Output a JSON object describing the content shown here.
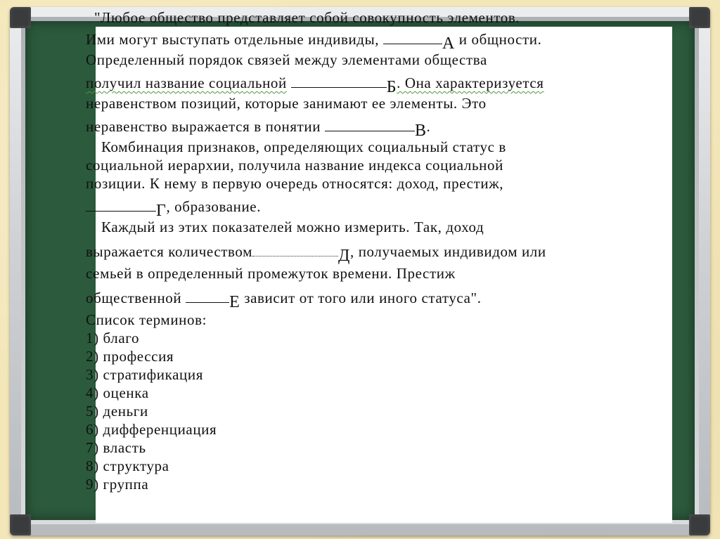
{
  "document": {
    "lines": [
      "\"Любое общество представляет собой совокупность элементов.",
      "Ими могут выступать отдельные индивиды,",
      "и общности.",
      "Определенный порядок связей между элементами общества",
      "получил название социальной",
      ". Она характеризуется",
      "неравенством позиций, которые занимают ее элементы. Это",
      "неравенство выражается в понятии",
      ".",
      "Комбинация признаков, определяющих социальный статус в",
      "социальной иерархии, получила название индекса социальной",
      "позиции. К нему в первую очередь относятся: доход, престиж,",
      ", образование.",
      "Каждый из этих показателей можно измерить. Так, доход",
      "выражается количеством",
      ", получаемых индивидом или",
      "семьей в определенный промежуток времени. Престиж",
      "общественной",
      "зависит от того или иного статуса\"."
    ],
    "letters": [
      "А",
      "Б",
      "В",
      "Г",
      "Д",
      "Е"
    ],
    "list_title": "Список терминов:",
    "terms": [
      "1) благо",
      "2) профессия",
      "3) стратификация",
      "4) оценка",
      "5) деньги",
      "6) дифференциация",
      "7) власть",
      "8) структура",
      "9) группа"
    ]
  },
  "colors": {
    "board_green": "#2c5a3c",
    "paper": "#ffffff",
    "background": "#f3e6b8",
    "spellcheck_underline": "#4a9a3a"
  }
}
